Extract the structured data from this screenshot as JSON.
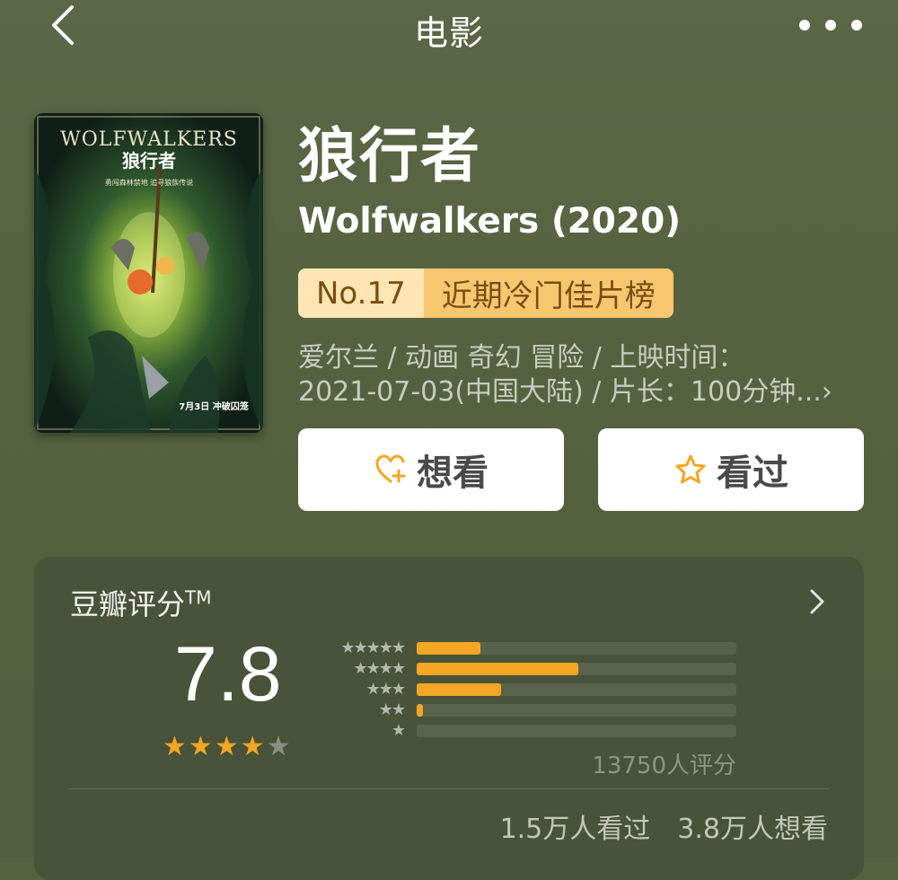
{
  "nav": {
    "title": "电影",
    "back_icon": "chevron-left-icon",
    "more_icon": "more-dots-icon"
  },
  "poster": {
    "title_en": "WOLFWALKERS",
    "title_cn": "狼行者",
    "tagline": "勇闯森林禁地 追寻狼族传说",
    "release": "7月3日 冲破囚笼"
  },
  "movie": {
    "title_cn": "狼行者",
    "title_en": "Wolfwalkers (2020)",
    "rank_no": "No.17",
    "rank_name": "近期冷门佳片榜",
    "meta_line1": "爱尔兰 / 动画 奇幻 冒险 / 上映时间：",
    "meta_line2": "2021-07-03(中国大陆) / 片长：100分钟...",
    "meta_chevron": "›"
  },
  "actions": {
    "want_label": "想看",
    "seen_label": "看过",
    "want_icon": "heart-plus-icon",
    "seen_icon": "star-outline-icon"
  },
  "rating": {
    "title": "豆瓣评分",
    "tm": "TM",
    "score": "7.8",
    "stars_filled": 4,
    "stars_total": 5,
    "distribution": [
      {
        "stars": "★★★★★",
        "fraction": 0.2
      },
      {
        "stars": "★★★★",
        "fraction": 0.505
      },
      {
        "stars": "★★★",
        "fraction": 0.265
      },
      {
        "stars": "★★",
        "fraction": 0.02
      },
      {
        "stars": "★",
        "fraction": 0.0
      }
    ],
    "votes": "13750人评分",
    "seen_count": "1.5万人看过",
    "want_count": "3.8万人想看"
  },
  "colors": {
    "accent": "#f5a623",
    "background": "#56623f",
    "card": "#48533a"
  }
}
